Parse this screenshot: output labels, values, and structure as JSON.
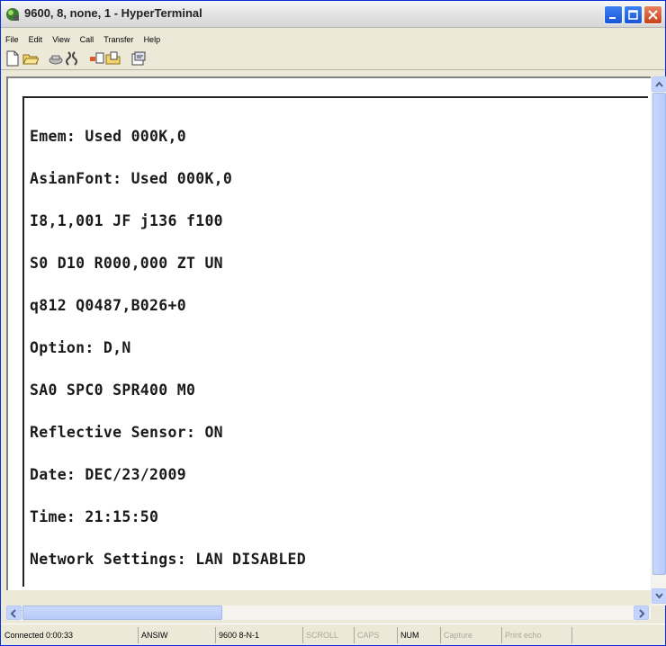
{
  "window": {
    "title": "9600, 8, none, 1 - HyperTerminal"
  },
  "menu": {
    "items": [
      {
        "label": "File"
      },
      {
        "label": "Edit"
      },
      {
        "label": "View"
      },
      {
        "label": "Call"
      },
      {
        "label": "Transfer"
      },
      {
        "label": "Help"
      }
    ]
  },
  "toolbar": {
    "buttons": [
      {
        "name": "new-connection-icon"
      },
      {
        "name": "open-icon"
      },
      {
        "name": "call-icon"
      },
      {
        "name": "disconnect-icon"
      },
      {
        "name": "send-icon"
      },
      {
        "name": "receive-icon"
      },
      {
        "name": "properties-icon"
      }
    ]
  },
  "terminal": {
    "lines": [
      "Emem: Used 000K,0",
      "AsianFont: Used 000K,0",
      "I8,1,001 JF j136 f100",
      "S0 D10 R000,000 ZT UN",
      "q812 Q0487,B026+0",
      "Option: D,N",
      "SA0 SPC0 SPR400 M0",
      "Reflective Sensor: ON",
      "Date: DEC/23/2009",
      "Time: 21:15:50",
      "Network Settings: LAN DISABLED"
    ]
  },
  "statusbar": {
    "connected": "Connected 0:00:33",
    "emulation": "ANSIW",
    "settings": "9600 8-N-1",
    "scroll": "SCROLL",
    "caps": "CAPS",
    "num": "NUM",
    "capture": "Capture",
    "print_echo": "Print echo"
  },
  "colors": {
    "title_gradient_top": "#f7f7f7",
    "close_button": "#c7411a",
    "minmax_button": "#1a55d8",
    "terminal_text": "#1a1a1a"
  }
}
